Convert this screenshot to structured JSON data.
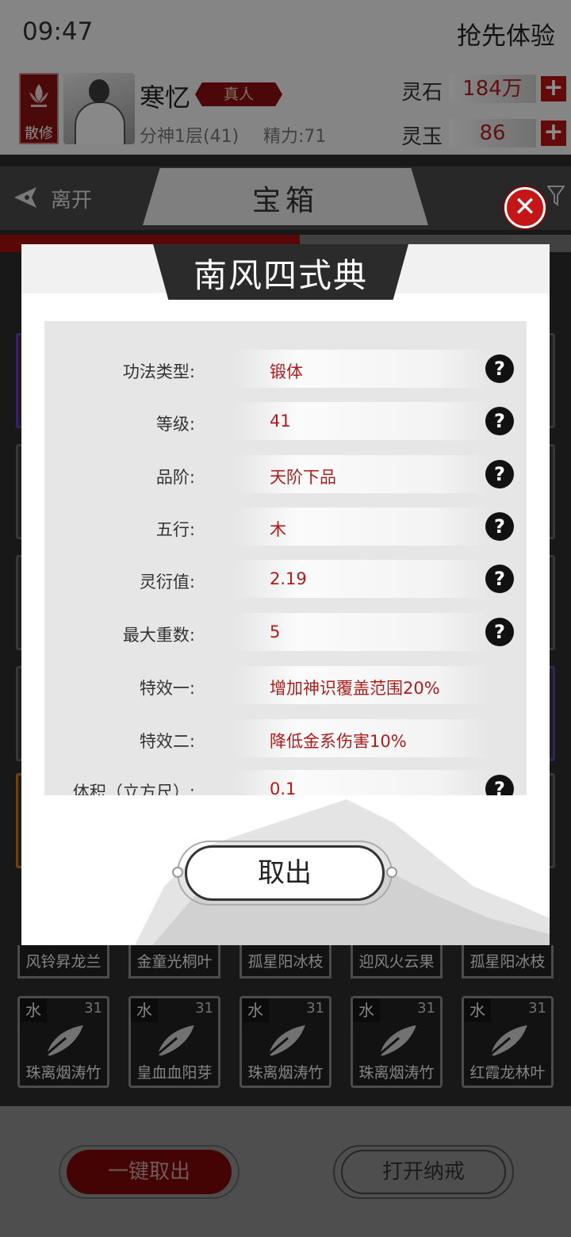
{
  "status": {
    "time": "09:47",
    "trial_label": "抢先体验"
  },
  "player": {
    "sect_label": "散修",
    "name": "寒忆",
    "tag": "真人",
    "realm": "分神1层(41)",
    "energy": "精力:71"
  },
  "resources": [
    {
      "label": "灵石",
      "value": "184万",
      "plus": "+"
    },
    {
      "label": "灵玉",
      "value": "86",
      "plus": "+"
    }
  ],
  "nav": {
    "back_label": "离开",
    "title": "宝箱"
  },
  "dialog": {
    "title": "南风四式典",
    "rows": [
      {
        "label": "功法类型:",
        "value": "锻体",
        "help": true
      },
      {
        "label": "等级:",
        "value": "41",
        "help": true
      },
      {
        "label": "品阶:",
        "value": "天阶下品",
        "help": true
      },
      {
        "label": "五行:",
        "value": "木",
        "help": true
      },
      {
        "label": "灵衍值:",
        "value": "2.19",
        "help": true
      },
      {
        "label": "最大重数:",
        "value": "5",
        "help": true
      },
      {
        "label": "特效一:",
        "value": "增加神识覆盖范围20%",
        "help": false
      },
      {
        "label": "特效二:",
        "value": "降低金系伤害10%",
        "help": false
      },
      {
        "label": "体积（立方尺）:",
        "value": "0.1",
        "help": true
      }
    ],
    "help_glyph": "?",
    "confirm_label": "取出",
    "close_glyph": "✕"
  },
  "grid": {
    "partial_row_names": [
      "风铃昇龙兰",
      "金童光桐叶",
      "孤星阳冰枝",
      "迎风火云果",
      "孤星阳冰枝"
    ],
    "items": [
      {
        "element": "水",
        "level": "31",
        "name": "珠离烟涛竹"
      },
      {
        "element": "水",
        "level": "31",
        "name": "皇血血阳芽"
      },
      {
        "element": "水",
        "level": "31",
        "name": "珠离烟涛竹"
      },
      {
        "element": "水",
        "level": "31",
        "name": "珠离烟涛竹"
      },
      {
        "element": "水",
        "level": "31",
        "name": "红霞龙林叶"
      }
    ]
  },
  "actions": {
    "take_all_label": "一键取出",
    "open_ring_label": "打开纳戒"
  },
  "colors": {
    "accent_red": "#b01c1c",
    "dark_red": "#7c0808",
    "value_red": "#b01c1c"
  }
}
